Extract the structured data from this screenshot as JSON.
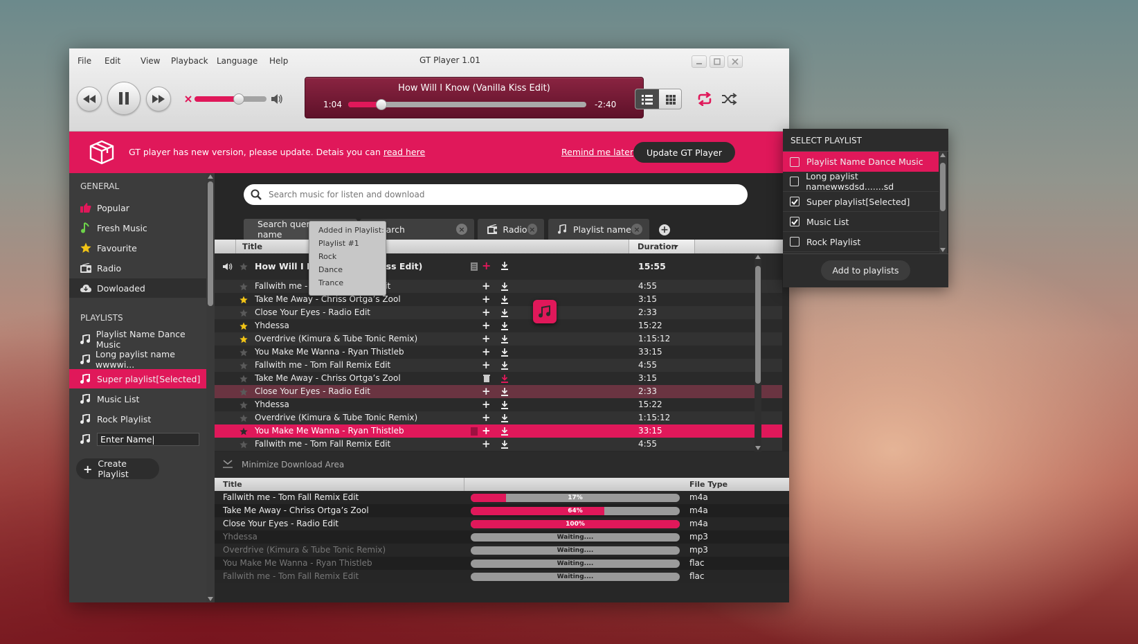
{
  "menu": [
    "File",
    "Edit",
    "View",
    "Playback",
    "Language",
    "Help"
  ],
  "app_title": "GT Player 1.01",
  "now_playing": {
    "title": "How Will I Know (Vanilla Kiss Edit)",
    "elapsed": "1:04",
    "remaining": "-2:40",
    "progress": 0.14
  },
  "volume": 0.62,
  "banner": {
    "message": "GT player has new version, please update. Detais you can ",
    "link": "read here",
    "remind": "Remind me later",
    "update": "Update GT Player"
  },
  "sidebar": {
    "general_title": "GENERAL",
    "general": [
      {
        "label": "Popular",
        "icon": "thumbs-up-icon"
      },
      {
        "label": "Fresh Music",
        "icon": "music-note-icon"
      },
      {
        "label": "Favourite",
        "icon": "star-icon"
      },
      {
        "label": "Radio",
        "icon": "radio-icon"
      },
      {
        "label": "Dowloaded",
        "icon": "cloud-download-icon"
      }
    ],
    "playlists_title": "PLAYLISTS",
    "playlists": [
      "Playlist Name Dance Music",
      "Long paylist name wwwwi...",
      "Super playlist[Selected]",
      "Music List",
      "Rock Playlist"
    ],
    "new_playlist_value": "Enter Name|",
    "create": "Create Playlist"
  },
  "search": {
    "placeholder": "Search music for listen and download"
  },
  "tabs": [
    "Search query name",
    "Search",
    "Radio",
    "Playlist name"
  ],
  "table_header": {
    "title": "Title",
    "duration": "Duration"
  },
  "current_track": {
    "title": "How Will I Know (Vanilla Kiss Edit)",
    "duration": "15:55"
  },
  "tracks": [
    {
      "title": "Fallwith me - Tom Fall Remix Edit",
      "duration": "4:55",
      "starred": false
    },
    {
      "title": "Take Me Away - Chriss Ortga’s Zool",
      "duration": "3:15",
      "starred": true
    },
    {
      "title": "Close Your Eyes - Radio Edit",
      "duration": "2:33",
      "starred": false
    },
    {
      "title": "Yhdessa",
      "duration": "15:22",
      "starred": true
    },
    {
      "title": "Overdrive (Kimura & Tube Tonic Remix)",
      "duration": "1:15:12",
      "starred": true
    },
    {
      "title": "You Make Me Wanna - Ryan Thistleb",
      "duration": "33:15",
      "starred": false
    },
    {
      "title": "Fallwith me - Tom Fall Remix Edit",
      "duration": "4:55",
      "starred": false
    },
    {
      "title": "Take Me Away - Chriss Ortga’s Zool",
      "duration": "3:15",
      "starred": false
    },
    {
      "title": "Close Your Eyes - Radio Edit",
      "duration": "2:33",
      "starred": false
    },
    {
      "title": "Yhdessa",
      "duration": "15:22",
      "starred": false
    },
    {
      "title": "Overdrive (Kimura & Tube Tonic Remix)",
      "duration": "1:15:12",
      "starred": false
    },
    {
      "title": "You Make Me Wanna - Ryan Thistleb",
      "duration": "33:15",
      "starred": false
    },
    {
      "title": "Fallwith me - Tom Fall Remix Edit",
      "duration": "4:55",
      "starred": false
    }
  ],
  "popup": {
    "header": "Added in Playlist:",
    "items": [
      "Playlist #1",
      "Rock",
      "Dance",
      "Trance"
    ]
  },
  "download": {
    "minimize": "Minimize Download Area",
    "header": {
      "title": "Title",
      "filetype": "File Type"
    },
    "items": [
      {
        "title": "Fallwith me - Tom Fall Remix Edit",
        "progress": 0.17,
        "label": "17%",
        "type": "m4a"
      },
      {
        "title": "Take Me Away - Chriss Ortga’s Zool",
        "progress": 0.64,
        "label": "64%",
        "type": "m4a"
      },
      {
        "title": "Close Your Eyes - Radio Edit",
        "progress": 1.0,
        "label": "100%",
        "type": "m4a"
      },
      {
        "title": "Yhdessa",
        "progress": 0,
        "label": "Waiting....",
        "type": "mp3"
      },
      {
        "title": "Overdrive (Kimura & Tube Tonic Remix)",
        "progress": 0,
        "label": "Waiting....",
        "type": "mp3"
      },
      {
        "title": "You Make Me Wanna - Ryan Thistleb",
        "progress": 0,
        "label": "Waiting....",
        "type": "flac"
      },
      {
        "title": "Fallwith me - Tom Fall Remix Edit",
        "progress": 0,
        "label": "Waiting....",
        "type": "flac"
      }
    ]
  },
  "select_playlist": {
    "title": "SELECT PLAYLIST",
    "items": [
      {
        "label": "Playlist Name Dance Music",
        "checked": false
      },
      {
        "label": "Long paylist namewwsdsd.......sd",
        "checked": false
      },
      {
        "label": "Super playlist[Selected]",
        "checked": true
      },
      {
        "label": "Music List",
        "checked": true
      },
      {
        "label": "Rock Playlist",
        "checked": false
      }
    ],
    "button": "Add to playlists"
  },
  "colors": {
    "accent": "#e0185a",
    "star": "#f2c416",
    "dark": "#272727"
  }
}
